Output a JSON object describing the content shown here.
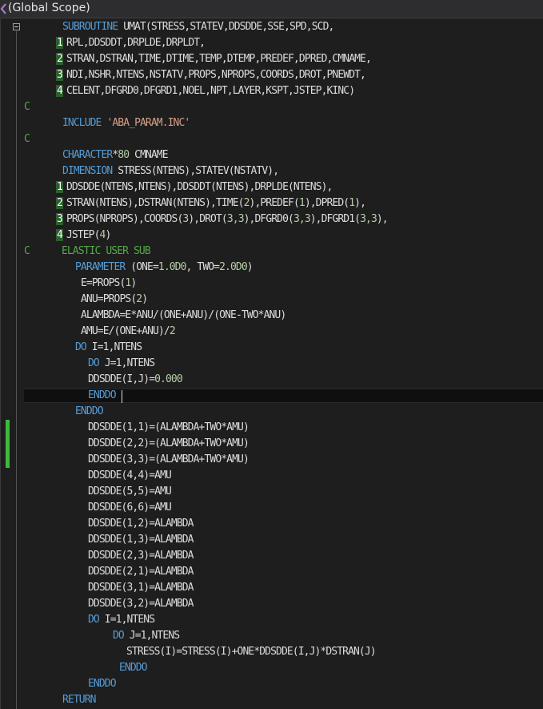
{
  "scope": {
    "label": "(Global Scope)"
  },
  "code": {
    "l01": {
      "kw": "SUBROUTINE",
      "text": " UMAT(STRESS,STATEV,DDSDDE,SSE,SPD,SCD,"
    },
    "l02": {
      "cont": "1",
      "text": "RPL,DDSDDT,DRPLDE,DRPLDT,"
    },
    "l03": {
      "cont": "2",
      "text": "STRAN,DSTRAN,TIME,DTIME,TEMP,DTEMP,PREDEF,DPRED,CMNAME,"
    },
    "l04": {
      "cont": "3",
      "text": "NDI,NSHR,NTENS,NSTATV,PROPS,NPROPS,COORDS,DROT,PNEWDT,"
    },
    "l05": {
      "cont": "4",
      "text": "CELENT,DFGRD0,DFGRD1,NOEL,NPT,LAYER,KSPT,JSTEP,KINC)"
    },
    "l06": {
      "cm": "C"
    },
    "l07": {
      "kw": "INCLUDE",
      "str": "'ABA_PARAM.INC'"
    },
    "l08": {
      "cm": "C"
    },
    "l09": {
      "kw": "CHARACTER",
      "text_a": "*",
      "num": "80",
      "text_b": " CMNAME"
    },
    "l10": {
      "kw": "DIMENSION",
      "text": " STRESS(NTENS),STATEV(NSTATV),"
    },
    "l11": {
      "cont": "1",
      "text": "DDSDDE(NTENS,NTENS),DDSDDT(NTENS),DRPLDE(NTENS),"
    },
    "l12": {
      "cont": "2",
      "text_a": "STRAN(NTENS),DSTRAN(NTENS),TIME(",
      "num_a": "2",
      "text_b": "),PREDEF(",
      "num_b": "1",
      "text_c": "),DPRED(",
      "num_c": "1",
      "text_d": "),"
    },
    "l13": {
      "cont": "3",
      "text_a": "PROPS(NPROPS),COORDS(",
      "num_a": "3",
      "text_b": "),DROT(",
      "num_b": "3,3",
      "text_c": "),DFGRD0(",
      "num_c": "3,3",
      "text_d": "),DFGRD1(",
      "num_d": "3,3",
      "text_e": "),"
    },
    "l14": {
      "cont": "4",
      "text_a": "JSTEP(",
      "num": "4",
      "text_b": ")"
    },
    "l15": {
      "cm_a": "C",
      "cm_b": "ELASTIC USER SUB"
    },
    "l16": {
      "kw": "PARAMETER",
      "text_a": " (ONE=",
      "num_a": "1.0D0",
      "text_b": ", TWO=",
      "num_b": "2.0D0",
      "text_c": ")"
    },
    "l17": {
      "text_a": "E=PROPS(",
      "num": "1",
      "text_b": ")"
    },
    "l18": {
      "text_a": "ANU=PROPS(",
      "num": "2",
      "text_b": ")"
    },
    "l19": {
      "text": "ALAMBDA=E*ANU/(ONE+ANU)/(ONE-TWO*ANU)"
    },
    "l20": {
      "text_a": "AMU=E/(ONE+ANU)/",
      "num": "2"
    },
    "l21": {
      "kw": "DO",
      "text": " I=1,NTENS"
    },
    "l22": {
      "kw": "DO",
      "text": " J=1,NTENS"
    },
    "l23": {
      "text": "DDSDDE(I,J)=",
      "num": "0.000"
    },
    "l24": {
      "kw": "ENDDO"
    },
    "l25": {
      "kw": "ENDDO"
    },
    "l26": {
      "text": "DDSDDE(1,1)=(ALAMBDA+TWO*AMU)"
    },
    "l27": {
      "text": "DDSDDE(2,2)=(ALAMBDA+TWO*AMU)"
    },
    "l28": {
      "text": "DDSDDE(3,3)=(ALAMBDA+TWO*AMU)"
    },
    "l29": {
      "text": "DDSDDE(4,4)=AMU"
    },
    "l30": {
      "text": "DDSDDE(5,5)=AMU"
    },
    "l31": {
      "text": "DDSDDE(6,6)=AMU"
    },
    "l32": {
      "text": "DDSDDE(1,2)=ALAMBDA"
    },
    "l33": {
      "text": "DDSDDE(1,3)=ALAMBDA"
    },
    "l34": {
      "text": "DDSDDE(2,3)=ALAMBDA"
    },
    "l35": {
      "text": "DDSDDE(2,1)=ALAMBDA"
    },
    "l36": {
      "text": "DDSDDE(3,1)=ALAMBDA"
    },
    "l37": {
      "text": "DDSDDE(3,2)=ALAMBDA"
    },
    "l38": {
      "kw": "DO",
      "text": " I=1,NTENS"
    },
    "l39": {
      "kw": "DO",
      "text": " J=1,NTENS"
    },
    "l40": {
      "text": "STRESS(I)=STRESS(I)+ONE*DDSDDE(I,J)*DSTRAN(J)"
    },
    "l41": {
      "kw": "ENDDO"
    },
    "l42": {
      "kw": "ENDDO"
    },
    "l43": {
      "kw": "RETURN"
    }
  },
  "colors": {
    "background": "#1e1e1e",
    "keyword": "#569cd6",
    "comment": "#57a64a",
    "string": "#d69d85",
    "number": "#b5cea8",
    "text": "#dcdcdc",
    "change_marker": "#3fb83f"
  }
}
